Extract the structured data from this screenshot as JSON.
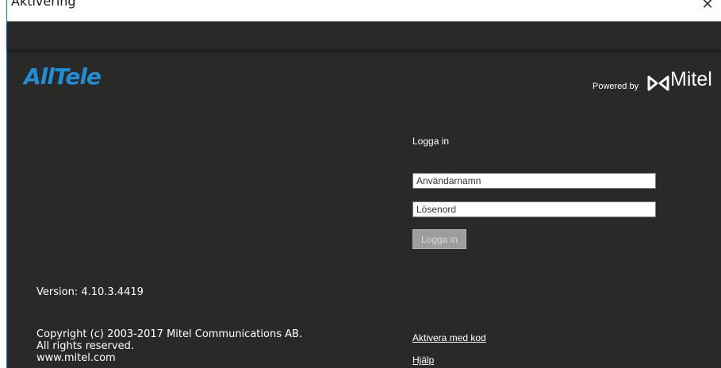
{
  "window": {
    "title": "Aktivering",
    "close_glyph": "✕"
  },
  "brand": {
    "logo_text": "AllTele",
    "powered_by": "Powered by",
    "mitel_text": "Mitel",
    "mitel_icon": "mitel-infinity-icon",
    "accent_color": "#1f8ed6"
  },
  "login": {
    "heading": "Logga in",
    "username_placeholder": "Användarnamn",
    "password_placeholder": "Lösenord",
    "submit_label": "Logga in"
  },
  "footer": {
    "version": "Version: 4.10.3.4419",
    "copyright_lines": [
      "Copyright (c) 2003-2017 Mitel Communications AB.",
      "All rights reserved.",
      "www.mitel.com"
    ],
    "activate_link": "Aktivera med kod",
    "help_link": "Hjälp"
  }
}
